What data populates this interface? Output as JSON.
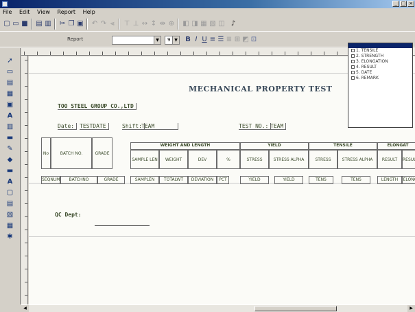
{
  "window": {
    "title": "",
    "menu": [
      "File",
      "Edit",
      "View",
      "Report",
      "Help"
    ]
  },
  "toolbar": {
    "style_label": "Report",
    "font_combo": "",
    "size_combo": "9"
  },
  "report": {
    "title": "MECHANICAL PROPERTY TEST",
    "company": "TOO STEEL GROUP CO.,LTD",
    "date_label": "Date:",
    "date_value": "TESTDATE",
    "shift_label": "Shift:",
    "shift_value": "TEAM",
    "test_no_label": "TEST NO.:",
    "test_no_value": "TEAM",
    "dc_label": "QC Dept:"
  },
  "table": {
    "group_headers": [
      "WEIGHT AND LENGTH",
      "YIELD",
      "TENSILE",
      "ELONGAT"
    ],
    "col_headers": [
      "No",
      "BATCH NO.",
      "GRADE",
      "SAMPLE LEN",
      "WEIGHT",
      "DEV",
      "%",
      "STRESS",
      "STRESS ALPHA",
      "STRESS",
      "STRESS ALPHA",
      "RESULT",
      "RESULT"
    ],
    "row_values": [
      "SEQNUM",
      "BATCHNO",
      "GRADE",
      "SAMPLEN",
      "TOTALWT",
      "DEVIATION",
      "PCT",
      "YIELD",
      "YIELD",
      "TENS",
      "TENS",
      "LENGTH",
      "ELONG"
    ]
  },
  "selector": {
    "items": [
      "1. TENSILE",
      "2. STRENGTH",
      "3. ELONGATION",
      "4. RESULT",
      "5. DATE",
      "6. REMARK"
    ]
  },
  "colors": {
    "titlebar": "#0a246a",
    "chrome": "#d4d0c8",
    "canvas": "#fbfbf7"
  }
}
